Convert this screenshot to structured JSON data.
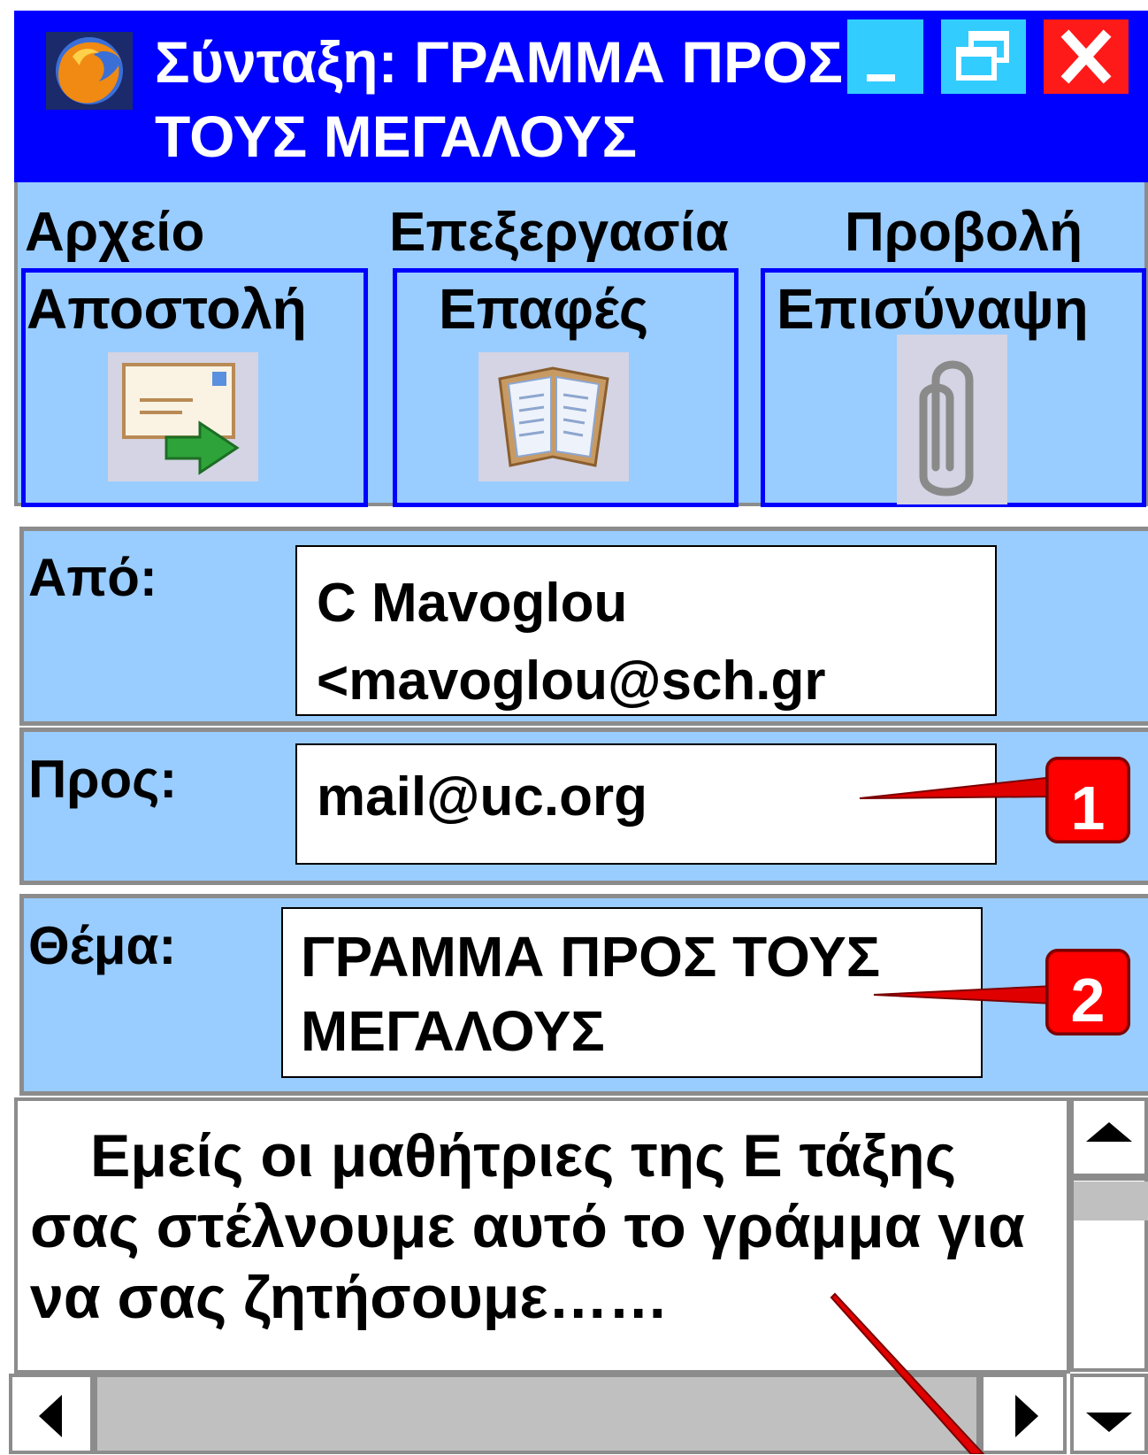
{
  "window": {
    "title": "Σύνταξη: ΓΡΑΜΜΑ ΠΡΟΣ …ΤΟΥΣ ΜΕΓΑΛΟΥΣ",
    "app_icon": "firefox-globe-icon",
    "controls": [
      "minimize-icon",
      "restore-icon",
      "close-icon"
    ]
  },
  "menu": {
    "file": "Αρχείο",
    "edit": "Επεξεργασία",
    "view": "Προβολή"
  },
  "toolbar": {
    "send": {
      "label": "Αποστολή",
      "icon": "send-mail-icon"
    },
    "contacts": {
      "label": "Επαφές",
      "icon": "address-book-icon"
    },
    "attach": {
      "label": "Επισύναψη",
      "icon": "paperclip-icon"
    }
  },
  "headers": {
    "from_label": "Από:",
    "from_value": "C Mavoglou <mavoglou@sch.gr",
    "to_label": "Προς:",
    "to_value": "mail@uc.org",
    "subject_label": "Θέμα:",
    "subject_value": "ΓΡΑΜΜΑ ΠΡΟΣ ΤΟΥΣ ΜΕΓΑΛΟΥΣ"
  },
  "callouts": {
    "one": "1",
    "two": "2"
  },
  "message": {
    "body": "Εμείς οι μαθήτριες της Ε τάξης σας στέλνουμε αυτό το γράμμα για να σας ζητήσουμε……"
  },
  "colors": {
    "titlebar": "#0000ff",
    "panel": "#99ccff",
    "callout": "#ff0000",
    "close": "#ff1a1a",
    "window_buttons": "#33ccff"
  }
}
